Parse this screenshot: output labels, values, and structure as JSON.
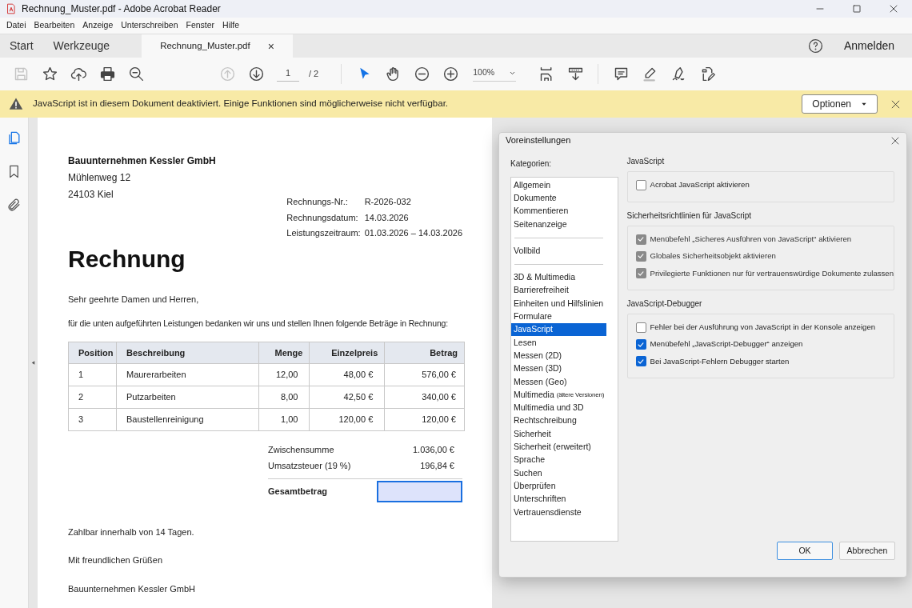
{
  "window": {
    "title": "Rechnung_Muster.pdf - Adobe Acrobat Reader"
  },
  "menu": [
    "Datei",
    "Bearbeiten",
    "Anzeige",
    "Unterschreiben",
    "Fenster",
    "Hilfe"
  ],
  "tabs": [
    {
      "label": "Start",
      "selected": false,
      "kind": "nav"
    },
    {
      "label": "Werkzeuge",
      "selected": false,
      "kind": "nav"
    },
    {
      "label": "Rechnung_Muster.pdf",
      "selected": true,
      "kind": "document",
      "close": "×"
    }
  ],
  "sign_in": "Anmelden",
  "toolbar": {
    "tools": [
      {
        "kind": "save",
        "disabled": true,
        "active": false
      },
      {
        "kind": "star",
        "disabled": false,
        "active": false
      },
      {
        "kind": "upload",
        "disabled": false,
        "active": false
      },
      {
        "kind": "print",
        "disabled": false,
        "active": false
      },
      {
        "kind": "zoomsearch",
        "disabled": false,
        "active": false
      },
      {
        "kind": "gap"
      },
      {
        "kind": "up",
        "disabled": true,
        "active": false
      },
      {
        "kind": "down",
        "disabled": false,
        "active": false
      },
      {
        "kind": "page"
      },
      {
        "kind": "sep"
      },
      {
        "kind": "pointer",
        "disabled": false,
        "active": true
      },
      {
        "kind": "hand",
        "disabled": false,
        "active": false
      },
      {
        "kind": "minus",
        "disabled": false,
        "active": false
      },
      {
        "kind": "plus",
        "disabled": false,
        "active": false
      },
      {
        "kind": "zoom"
      },
      {
        "kind": "fit",
        "disabled": false,
        "active": false
      },
      {
        "kind": "scroll",
        "disabled": false,
        "active": false
      },
      {
        "kind": "sep"
      },
      {
        "kind": "comment",
        "disabled": false,
        "active": false
      },
      {
        "kind": "pen",
        "disabled": false,
        "active": false
      },
      {
        "kind": "sign",
        "disabled": false,
        "active": false
      },
      {
        "kind": "fill",
        "disabled": false,
        "active": false
      }
    ],
    "page_current": "1",
    "page_total": "/ 2",
    "zoom": "100%"
  },
  "banner": {
    "message": "JavaScript ist in diesem Dokument deaktiviert. Einige Funktionen sind möglicherweise nicht verfügbar.",
    "button": "Optionen"
  },
  "sidebar": [
    {
      "kind": "pages",
      "selected": true
    },
    {
      "kind": "bookmark",
      "selected": false
    },
    {
      "kind": "attach",
      "selected": false
    }
  ],
  "document": {
    "company": "Bauunternehmen Kessler GmbH",
    "address": [
      "Mühlenweg 12",
      "24103 Kiel"
    ],
    "meta": [
      {
        "label": "Rechnungs-Nr.:",
        "value": "R-2026-032"
      },
      {
        "label": "Rechnungsdatum:",
        "value": "14.03.2026"
      },
      {
        "label": "Leistungszeitraum:",
        "value": "01.03.2026 – 14.03.2026"
      }
    ],
    "heading": "Rechnung",
    "salutation": "Sehr geehrte Damen und Herren,",
    "intro": "für die unten aufgeführten Leistungen bedanken wir uns und stellen Ihnen folgende Beträge in Rechnung:",
    "table": {
      "columns": [
        "Position",
        "Beschreibung",
        "Menge",
        "Einzelpreis",
        "Betrag"
      ],
      "rows": [
        [
          "1",
          "Maurerarbeiten",
          "12,00",
          "48,00 €",
          "576,00 €"
        ],
        [
          "2",
          "Putzarbeiten",
          "8,00",
          "42,50 €",
          "340,00 €"
        ],
        [
          "3",
          "Baustellenreinigung",
          "1,00",
          "120,00 €",
          "120,00 €"
        ]
      ]
    },
    "totals": [
      {
        "label": "Zwischensumme",
        "value": "1.036,00 €"
      },
      {
        "label": "Umsatzsteuer (19 %)",
        "value": "196,84 €"
      }
    ],
    "grand_total": {
      "label": "Gesamtbetrag",
      "focused": true
    },
    "closing": [
      "Zahlbar innerhalb von 14 Tagen.",
      "Mit freundlichen Grüßen",
      "Bauunternehmen Kessler GmbH"
    ]
  },
  "dialog": {
    "title": "Voreinstellungen",
    "categories_label": "Kategorien:",
    "category_groups": [
      {
        "items": [
          {
            "label": "Allgemein",
            "selected": false
          },
          {
            "label": "Dokumente",
            "selected": false
          },
          {
            "label": "Kommentieren",
            "selected": false
          },
          {
            "label": "Seitenanzeige",
            "selected": false
          }
        ]
      },
      {
        "items": [
          {
            "label": "Vollbild",
            "selected": false
          }
        ]
      },
      {
        "items": [
          {
            "label": "3D & Multimedia",
            "selected": false
          },
          {
            "label": "Barrierefreiheit",
            "selected": false
          },
          {
            "label": "Einheiten und Hilfslinien",
            "selected": false
          },
          {
            "label": "Formulare",
            "selected": false
          },
          {
            "label": "JavaScript",
            "selected": true
          },
          {
            "label": "Lesen",
            "selected": false
          },
          {
            "label": "Messen (2D)",
            "selected": false
          },
          {
            "label": "Messen (3D)",
            "selected": false
          },
          {
            "label": "Messen (Geo)",
            "selected": false
          },
          {
            "label": "Multimedia",
            "note": "(ältere Versionen)",
            "selected": false
          },
          {
            "label": "Multimedia und 3D",
            "selected": false
          },
          {
            "label": "Rechtschreibung",
            "selected": false
          },
          {
            "label": "Sicherheit",
            "selected": false
          },
          {
            "label": "Sicherheit (erweitert)",
            "selected": false
          },
          {
            "label": "Sprache",
            "selected": false
          },
          {
            "label": "Suchen",
            "selected": false
          },
          {
            "label": "Überprüfen",
            "selected": false
          },
          {
            "label": "Unterschriften",
            "selected": false
          },
          {
            "label": "Vertrauensdienste",
            "selected": false
          }
        ]
      }
    ],
    "sections": [
      {
        "title": "JavaScript",
        "options": [
          {
            "label": "Acrobat JavaScript aktivieren",
            "checked": false,
            "disabled": false
          }
        ]
      },
      {
        "title": "Sicherheitsrichtlinien für JavaScript",
        "options": [
          {
            "label": "Menübefehl „Sicheres Ausführen von JavaScript“ aktivieren",
            "checked": true,
            "disabled": true
          },
          {
            "label": "Globales Sicherheitsobjekt aktivieren",
            "checked": true,
            "disabled": true
          },
          {
            "label": "Privilegierte Funktionen nur für vertrauenswürdige Dokumente zulassen",
            "checked": true,
            "disabled": true
          }
        ]
      },
      {
        "title": "JavaScript-Debugger",
        "options": [
          {
            "label": "Fehler bei der Ausführung von JavaScript in der Konsole anzeigen",
            "checked": false,
            "disabled": false
          },
          {
            "label": "Menübefehl „JavaScript-Debugger“ anzeigen",
            "checked": true,
            "disabled": false
          },
          {
            "label": "Bei JavaScript-Fehlern Debugger starten",
            "checked": true,
            "disabled": false
          }
        ]
      }
    ],
    "buttons": [
      {
        "label": "OK",
        "default": true
      },
      {
        "label": "Abbrechen",
        "default": false
      }
    ]
  }
}
